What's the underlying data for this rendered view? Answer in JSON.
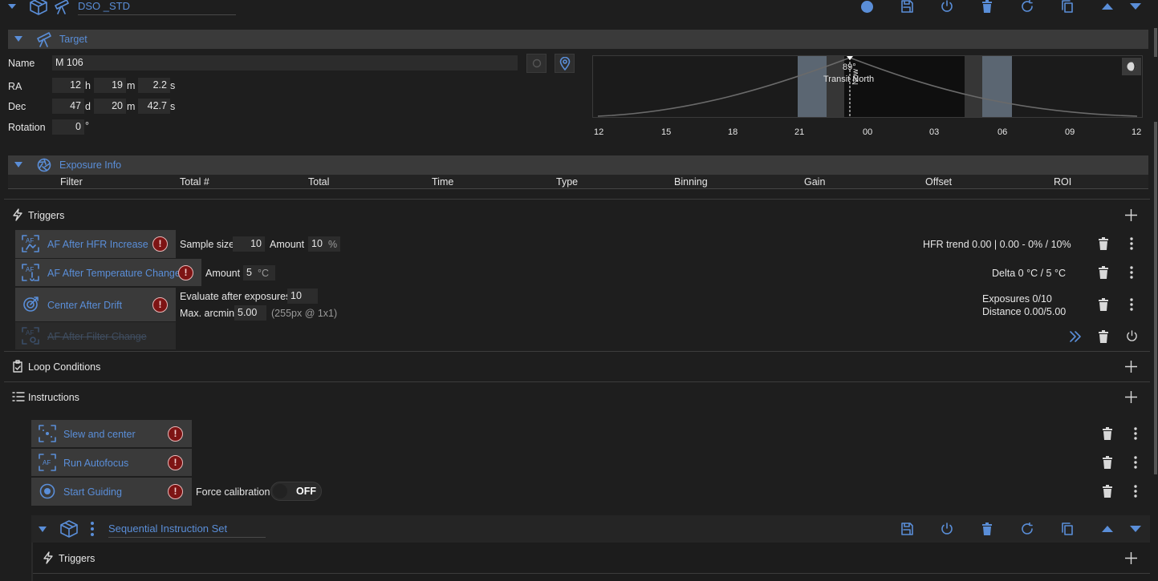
{
  "header": {
    "title": "DSO _STD",
    "icons": [
      "collapse-chevron-icon",
      "box-icon",
      "telescope-icon",
      "circle-icon",
      "save-icon",
      "power-icon",
      "trash-icon",
      "reset-icon",
      "copy-icon",
      "move-up-icon",
      "move-down-icon"
    ]
  },
  "target": {
    "section_title": "Target",
    "name_label": "Name",
    "name_value": "M 106",
    "ra_label": "RA",
    "ra_h": "12",
    "ra_h_unit": "h",
    "ra_m": "19",
    "ra_m_unit": "m",
    "ra_s": "2.2",
    "ra_s_unit": "s",
    "dec_label": "Dec",
    "dec_d": "47",
    "dec_d_unit": "d",
    "dec_m": "20",
    "dec_m_unit": "m",
    "dec_s": "42.7",
    "dec_s_unit": "s",
    "rotation_label": "Rotation",
    "rotation_value": "0",
    "rotation_unit": "°"
  },
  "altitude_chart": {
    "transit_alt": "89°",
    "transit_label": "Transit",
    "transit_dir": "North",
    "vertical_label": "Now",
    "x_ticks": [
      "12",
      "15",
      "18",
      "21",
      "00",
      "03",
      "06",
      "09",
      "12"
    ]
  },
  "chart_data": {
    "type": "area",
    "x": [
      "12",
      "15",
      "18",
      "21",
      "00",
      "03",
      "06",
      "09",
      "12"
    ],
    "ylabel": "",
    "xlabel": "",
    "annotations": [
      "89°",
      "Transit",
      "North",
      "Now"
    ]
  },
  "exposure_info": {
    "section_title": "Exposure Info",
    "columns": [
      "Filter",
      "Total #",
      "Total",
      "Time",
      "Type",
      "Binning",
      "Gain",
      "Offset",
      "ROI"
    ]
  },
  "triggers": {
    "title": "Triggers",
    "items": [
      {
        "name": "AF After HFR Increase",
        "sample_label": "Sample size",
        "sample_value": "10",
        "amount_label": "Amount",
        "amount_value": "10",
        "amount_unit": "%",
        "status": "HFR trend  0.00 | 0.00 - 0% / 10%"
      },
      {
        "name": "AF After Temperature Change",
        "amount_label": "Amount",
        "amount_value": "5",
        "amount_unit": "°C",
        "status": "Delta  0 °C / 5 °C"
      },
      {
        "name": "Center After Drift",
        "eval_label": "Evaluate after exposures",
        "eval_value": "10",
        "arcmin_label": "Max. arcmin",
        "arcmin_value": "5.00",
        "arcmin_note": "(255px @ 1x1)",
        "status_line1": "Exposures  0/10",
        "status_line2": "Distance  0.00/5.00"
      },
      {
        "name": "AF After Filter Change"
      }
    ]
  },
  "loop_conditions": {
    "title": "Loop Conditions"
  },
  "instructions": {
    "title": "Instructions",
    "items": [
      {
        "name": "Slew and center"
      },
      {
        "name": "Run Autofocus"
      },
      {
        "name": "Start Guiding",
        "option_label": "Force calibration",
        "toggle_value": "OFF"
      }
    ]
  },
  "sub_set": {
    "title": "Sequential Instruction Set",
    "triggers_title": "Triggers"
  },
  "colors": {
    "background": "#1e1e1e",
    "section_header": "#3a3a3a",
    "accent": "#5a8ed8",
    "warning": "#7d1414"
  }
}
